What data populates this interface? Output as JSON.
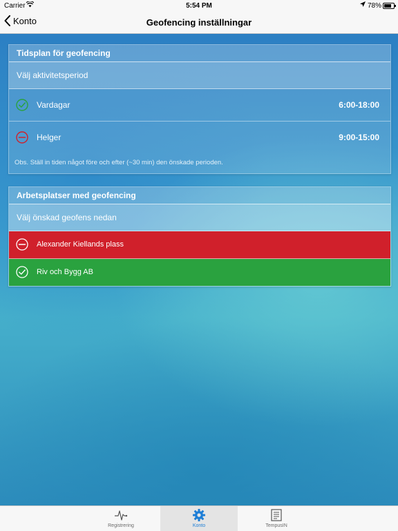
{
  "status_bar": {
    "carrier": "Carrier",
    "time": "5:54 PM",
    "battery_text": "78%",
    "battery_level": 0.78
  },
  "nav": {
    "back_label": "Konto",
    "title": "Geofencing inställningar"
  },
  "schedule": {
    "header": "Tidsplan för geofencing",
    "subheader": "Välj aktivitetsperiod",
    "rows": [
      {
        "label": "Vardagar",
        "time": "6:00-18:00",
        "icon": "check-circle-icon",
        "color": "#2aa23f"
      },
      {
        "label": "Helger",
        "time": "9:00-15:00",
        "icon": "minus-circle-icon",
        "color": "#d0202b"
      }
    ],
    "note": "Obs. Ställ in tiden något före och efter (~30 min) den önskade perioden."
  },
  "workplaces": {
    "header": "Arbetsplatser med geofencing",
    "subheader": "Välj önskad geofens nedan",
    "items": [
      {
        "label": "Alexander Kiellands plass",
        "status": "disabled",
        "icon": "minus-circle-icon",
        "color": "#d0202b"
      },
      {
        "label": "Riv och Bygg AB",
        "status": "enabled",
        "icon": "check-circle-icon",
        "color": "#2aa23f"
      }
    ]
  },
  "tabbar": {
    "tabs": [
      {
        "label": "Registrering",
        "icon": "pulse-icon",
        "active": false
      },
      {
        "label": "Konto",
        "icon": "gear-icon",
        "active": true
      },
      {
        "label": "TempusIN",
        "icon": "document-icon",
        "active": false
      }
    ],
    "active_color": "#1e7ed6"
  }
}
